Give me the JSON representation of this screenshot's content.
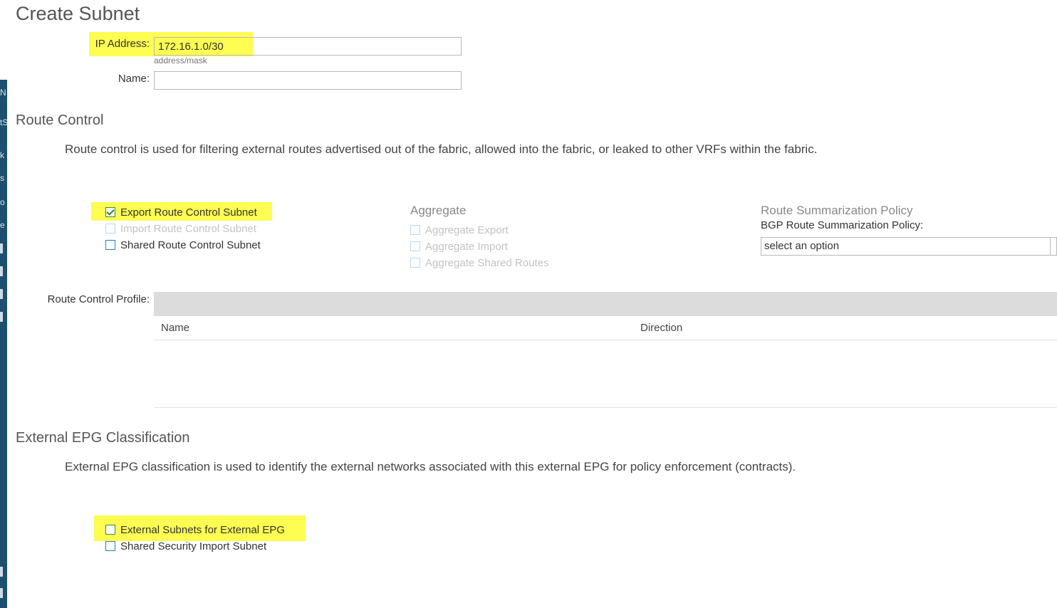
{
  "page": {
    "title": "Create Subnet"
  },
  "form": {
    "ip_label": "IP Address:",
    "ip_value": "172.16.1.0/30",
    "ip_hint": "address/mask",
    "name_label": "Name:",
    "name_value": ""
  },
  "route_control": {
    "title": "Route Control",
    "description": "Route control is used for filtering external routes advertised out of the fabric, allowed into the fabric, or leaked to other VRFs within the fabric.",
    "checkboxes": [
      {
        "label": "Export Route Control Subnet",
        "checked": true,
        "disabled": false
      },
      {
        "label": "Import Route Control Subnet",
        "checked": false,
        "disabled": true
      },
      {
        "label": "Shared Route Control Subnet",
        "checked": false,
        "disabled": false
      }
    ],
    "aggregate": {
      "title": "Aggregate",
      "items": [
        {
          "label": "Aggregate Export",
          "checked": false,
          "disabled": true
        },
        {
          "label": "Aggregate Import",
          "checked": false,
          "disabled": true
        },
        {
          "label": "Aggregate Shared Routes",
          "checked": false,
          "disabled": true
        }
      ]
    },
    "summarization": {
      "title": "Route Summarization Policy",
      "bgp_label": "BGP Route Summarization Policy:",
      "select_value": "select an option"
    },
    "profile": {
      "label": "Route Control Profile:",
      "columns": [
        "Name",
        "Direction"
      ]
    }
  },
  "external_epg": {
    "title": "External EPG Classification",
    "description": "External EPG classification is used to identify the external networks associated with this external EPG for policy enforcement (contracts).",
    "checkboxes": [
      {
        "label": "External Subnets for External EPG",
        "checked": false,
        "disabled": false
      },
      {
        "label": "Shared Security Import Subnet",
        "checked": false,
        "disabled": false
      }
    ]
  },
  "sidebar_chars": [
    "N",
    "tS",
    "k",
    "s",
    "o",
    "e"
  ],
  "colors": {
    "highlight": "#fdfd52",
    "sidebar": "#1d4f6e",
    "checkbox": "#2a7fc7",
    "check": "#2f8a22"
  }
}
